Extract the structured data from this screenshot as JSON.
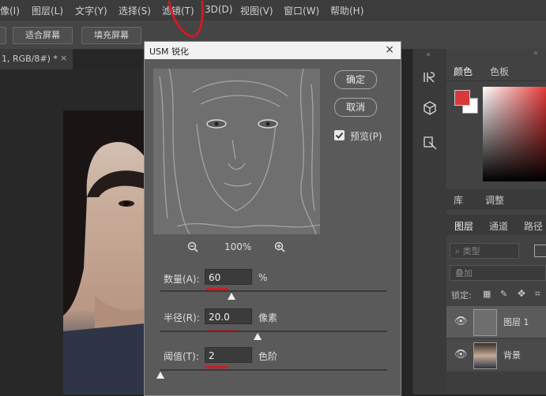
{
  "menubar": {
    "items": [
      "像(I)",
      "图层(L)",
      "文字(Y)",
      "选择(S)",
      "滤镜(T)",
      "3D(D)",
      "视图(V)",
      "窗口(W)",
      "帮助(H)"
    ]
  },
  "optbar": {
    "fit_screen": "适合屏幕",
    "fill_screen": "填充屏幕"
  },
  "doc_tab": {
    "title": "1, RGB/8#) *",
    "close": "×"
  },
  "dialog": {
    "title": "USM 锐化",
    "close": "×",
    "ok_label": "确定",
    "cancel_label": "取消",
    "preview_label": "预览(P)",
    "preview_checked": true,
    "zoom_level": "100%",
    "amount": {
      "label": "数量(A):",
      "value": "60",
      "unit": "%"
    },
    "radius": {
      "label": "半径(R):",
      "value": "20.0",
      "unit": "像素"
    },
    "threshold": {
      "label": "阈值(T):",
      "value": "2",
      "unit": "色阶"
    }
  },
  "panels": {
    "tabs_top": [
      "颜色",
      "色板"
    ],
    "tabs_mid": [
      "库",
      "调整"
    ],
    "tabs_layers": [
      "图层",
      "通道",
      "路径"
    ],
    "kind_filter": "类型",
    "blend_mode": "叠加",
    "lock_label": "锁定:",
    "foreground_color": "#d8393a",
    "layers": [
      {
        "name": "图层 1"
      },
      {
        "name": "背景"
      }
    ]
  },
  "accent": {
    "annotation_red": "#d01a26"
  }
}
